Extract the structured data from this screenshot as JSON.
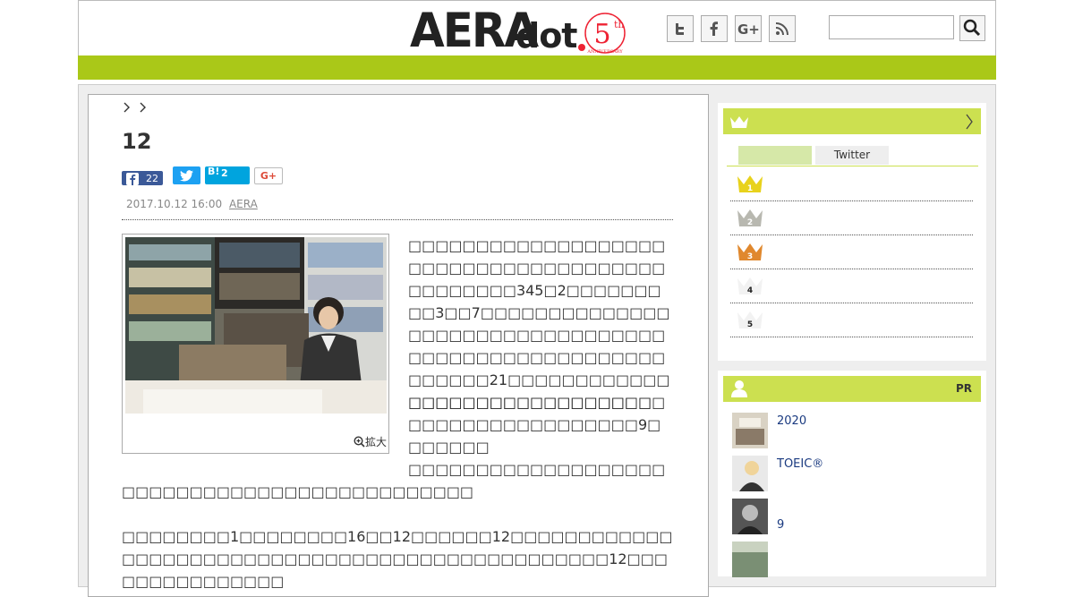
{
  "header": {
    "logo_main": "AERA",
    "logo_sub": "dot",
    "anniv_number": "5",
    "anniv_sup": "th",
    "anniv_text": "ANNIVERSARY",
    "social_icons": [
      "twitter-icon",
      "facebook-icon",
      "google-plus-icon",
      "rss-icon"
    ],
    "search_placeholder": ""
  },
  "breadcrumb": [
    "",
    ""
  ],
  "article": {
    "title": "12",
    "share": {
      "facebook_count": "22",
      "hatena_label": "B!",
      "hatena_count": "2",
      "gplus_label": "G+"
    },
    "date": "2017.10.12 16:00",
    "author": "AERA",
    "zoom_label": "拡大",
    "paragraphs": [
      "□□□□□□□□□□□□□□□□□□□□□□□□□□□□□□□□□□□□□□□□□□□□□□345□2□□□□□□□□□3□□7□□□□□□□□□□□□□□□□□□□□□□□□□□□□□□□□□□□□□□□□□□□□□□□□□□□□□□□□□□21□□□□□□□□□□□□□□□□□□□□□□□□□□□□□□",
      "□□□□□□□□□□□□□□□□□□□□□□□□□□□□□□□□□□□□9□□□□□□□",
      "□□□□□□□□□□□□□□□□□□□□□□□□□□□□□□□□□□□□□□□□□□□□□",
      "□□□□□□□□1□□□□□□□□16□□12□□□□□□12□□□□□□□□□□□□□□□□□□□□□□□□□□□□□□□□□□□□□□□□□□□□□□□□12□□□□□□□□□□□□□□□"
    ]
  },
  "sidebar": {
    "ranking": {
      "tabs": [
        "",
        "Twitter"
      ],
      "ranks": [
        "1",
        "2",
        "3",
        "4",
        "5"
      ]
    },
    "pr": {
      "label": "PR",
      "items": [
        "2020",
        "TOEIC®",
        "9",
        ""
      ]
    }
  },
  "colors": {
    "accent_green": "#aac818",
    "light_green": "#cce050"
  }
}
